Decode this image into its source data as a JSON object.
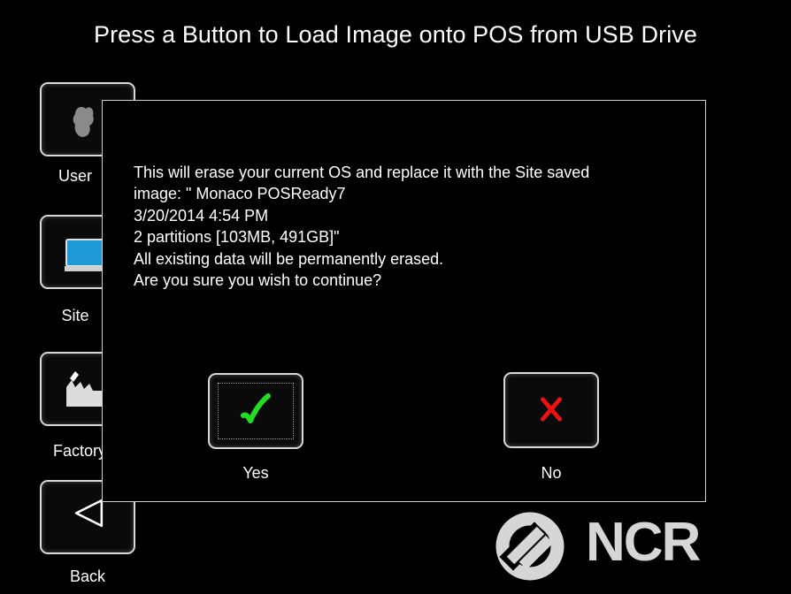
{
  "page": {
    "title": "Press a Button to Load Image onto POS from USB Drive"
  },
  "side_buttons": [
    {
      "label": "User",
      "icon": "user-phone-icon"
    },
    {
      "label": "Site",
      "icon": "monitor-icon"
    },
    {
      "label": "Factory",
      "icon": "factory-icon"
    },
    {
      "label": "Back",
      "icon": "back-arrow-icon"
    }
  ],
  "brand": {
    "name": "NCR",
    "logo_color": "#d6d6d6"
  },
  "dialog": {
    "message_lines": [
      "This will erase your current OS and replace it with the Site saved",
      "image: \" Monaco POSReady7",
      "3/20/2014 4:54 PM",
      "2 partitions [103MB, 491GB]\"",
      "All existing data will be permanently erased.",
      "Are you sure you wish to continue?"
    ],
    "yes_label": "Yes",
    "no_label": "No",
    "yes_icon": "checkmark-icon",
    "no_icon": "x-icon",
    "yes_color": "#22dd22",
    "no_color": "#ee1111"
  }
}
